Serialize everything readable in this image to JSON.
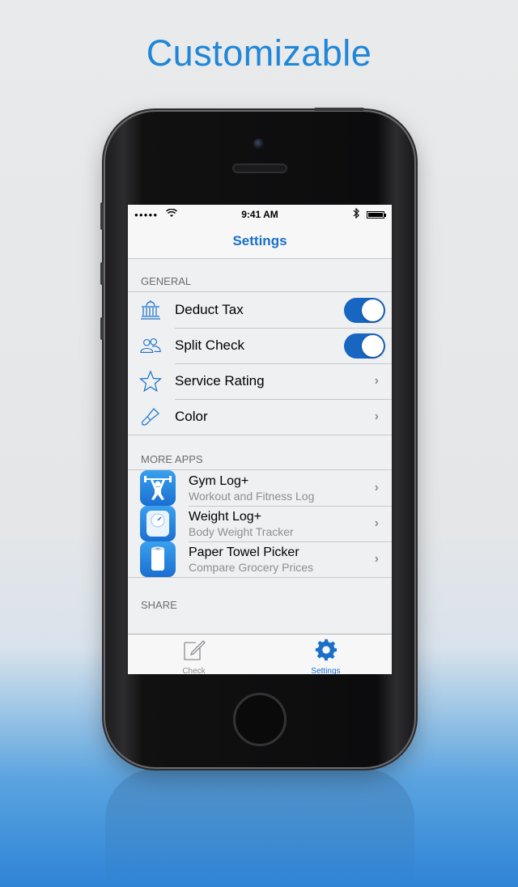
{
  "headline": "Customizable",
  "status_bar": {
    "signal": "●●●●●",
    "time": "9:41 AM"
  },
  "nav": {
    "title": "Settings"
  },
  "sections": {
    "general": {
      "header": "GENERAL",
      "rows": {
        "deduct_tax": {
          "label": "Deduct Tax",
          "icon": "bank-icon",
          "toggle": true
        },
        "split_check": {
          "label": "Split Check",
          "icon": "people-icon",
          "toggle": true
        },
        "service_rating": {
          "label": "Service Rating",
          "icon": "star-icon"
        },
        "color": {
          "label": "Color",
          "icon": "paintbrush-icon"
        }
      }
    },
    "more_apps": {
      "header": "MORE APPS",
      "apps": {
        "gym": {
          "title": "Gym Log+",
          "subtitle": "Workout and Fitness Log",
          "icon": "weightlifter-icon"
        },
        "weight": {
          "title": "Weight Log+",
          "subtitle": "Body Weight Tracker",
          "icon": "scale-icon"
        },
        "paper": {
          "title": "Paper Towel Picker",
          "subtitle": "Compare Grocery Prices",
          "icon": "paper-towel-icon"
        }
      }
    },
    "share": {
      "header": "SHARE"
    }
  },
  "tabbar": {
    "check": "Check",
    "settings": "Settings"
  },
  "colors": {
    "accent": "#1a70c9",
    "toggle_on": "#1766c2",
    "inactive_tab": "#8e8e93"
  }
}
